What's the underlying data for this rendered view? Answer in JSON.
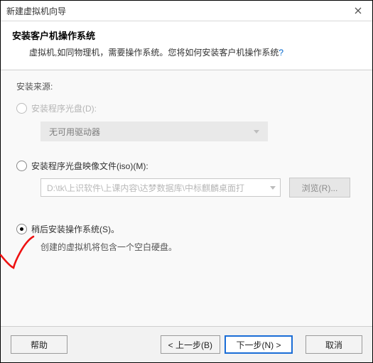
{
  "window": {
    "title": "新建虚拟机向导"
  },
  "header": {
    "title": "安装客户机操作系统",
    "subtitle_prefix": "虚拟机,如同物理机，需要操作系统。您将如何安装客户机操作系统",
    "subtitle_q": "?"
  },
  "body": {
    "source_label": "安装来源:",
    "opt_disc": {
      "label": "安装程序光盘(D):",
      "drive_text": "无可用驱动器"
    },
    "opt_iso": {
      "label": "安装程序光盘映像文件(iso)(M):",
      "path": "D:\\tk\\上识软件\\上课内容\\达梦数据库\\中标麒麟桌面打",
      "browse": "浏览(R)..."
    },
    "opt_later": {
      "label": "稍后安装操作系统(S)。",
      "desc": "创建的虚拟机将包含一个空白硬盘。"
    }
  },
  "footer": {
    "help": "帮助",
    "back": "< 上一步(B)",
    "next": "下一步(N) >",
    "cancel": "取消"
  }
}
